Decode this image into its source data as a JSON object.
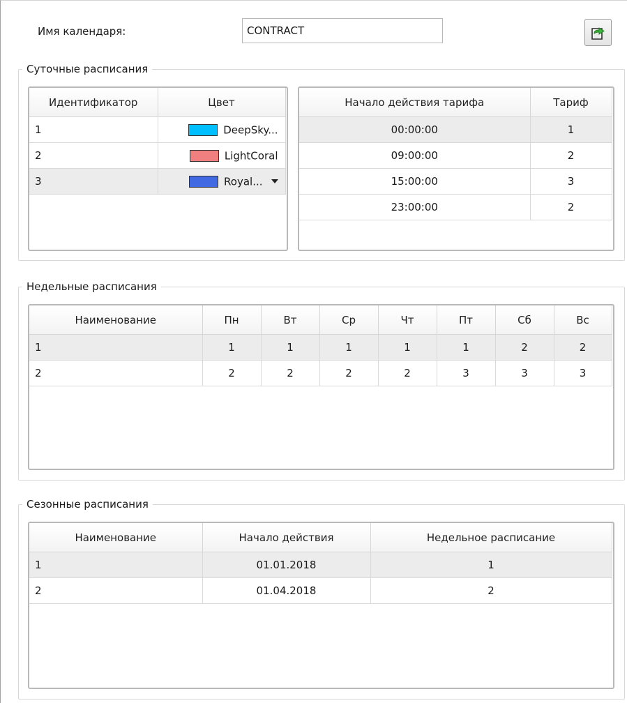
{
  "calendar": {
    "name_label": "Имя календаря:",
    "name_value": "CONTRACT",
    "export_icon": "export-icon"
  },
  "daily": {
    "title": "Суточные расписания",
    "profiles": {
      "headers": [
        "Идентификатор",
        "Цвет"
      ],
      "rows": [
        {
          "id": "1",
          "color_name": "DeepSky...",
          "color": "#00bfff"
        },
        {
          "id": "2",
          "color_name": "LightCoral",
          "color": "#f08080"
        },
        {
          "id": "3",
          "color_name": "Royal...",
          "color": "#4169e1"
        }
      ]
    },
    "tariffs": {
      "headers": [
        "Начало действия тарифа",
        "Тариф"
      ],
      "rows": [
        {
          "start": "00:00:00",
          "tariff": "1"
        },
        {
          "start": "09:00:00",
          "tariff": "2"
        },
        {
          "start": "15:00:00",
          "tariff": "3"
        },
        {
          "start": "23:00:00",
          "tariff": "2"
        }
      ]
    }
  },
  "weekly": {
    "title": "Недельные расписания",
    "headers": [
      "Наименование",
      "Пн",
      "Вт",
      "Ср",
      "Чт",
      "Пт",
      "Сб",
      "Вс"
    ],
    "rows": [
      [
        "1",
        "1",
        "1",
        "1",
        "1",
        "1",
        "2",
        "2"
      ],
      [
        "2",
        "2",
        "2",
        "2",
        "2",
        "3",
        "3",
        "3"
      ]
    ]
  },
  "seasonal": {
    "title": "Сезонные расписания",
    "headers": [
      "Наименование",
      "Начало действия",
      "Недельное расписание"
    ],
    "rows": [
      [
        "1",
        "01.01.2018",
        "1"
      ],
      [
        "2",
        "01.04.2018",
        "2"
      ]
    ]
  },
  "colors": {
    "selected_row": "#ececec",
    "grid_border": "#b9b9b9"
  }
}
